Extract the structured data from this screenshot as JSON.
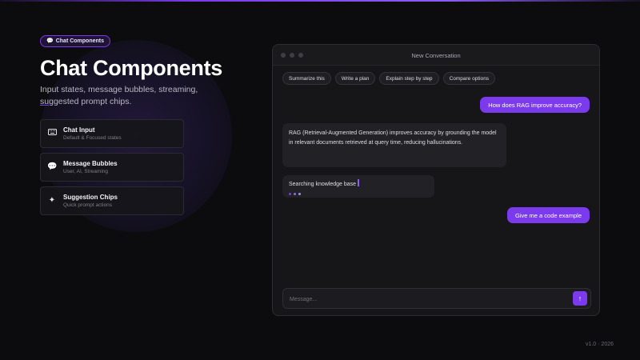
{
  "hero": {
    "badge_icon": "chat-bubble-icon",
    "badge_label": "Chat Components",
    "title": "Chat Components",
    "subtitle_a": "Input states, message bubbles, streaming, ",
    "subtitle_b": "sug",
    "subtitle_c": "gested prompt chips."
  },
  "cards": [
    {
      "icon": "keyboard-icon",
      "title": "Chat Input",
      "sub": "Default & Focused states"
    },
    {
      "icon": "speech-bubble-icon",
      "title": "Message Bubbles",
      "sub": "User, AI, Streaming"
    },
    {
      "icon": "sparkle-icon",
      "title": "Suggestion Chips",
      "sub": "Quick prompt actions"
    }
  ],
  "window": {
    "title": "New Conversation",
    "chips": [
      "Summarize this",
      "Write a plan",
      "Explain step by step",
      "Compare options"
    ],
    "messages": {
      "user1": "How does RAG improve accuracy?",
      "ai1": "RAG (Retrieval-Augmented Generation) improves accuracy by grounding the model in relevant documents retrieved at query time, reducing hallucinations.",
      "stream": "Searching knowledge base",
      "user2": "Give me a code example"
    },
    "composer": {
      "placeholder": "Message...",
      "value": ""
    }
  },
  "footer": {
    "version": "v1.0",
    "sep": "·",
    "year": "2026"
  },
  "colors": {
    "accent": "#7c3aed",
    "background": "#0c0c0e",
    "panel": "#161618"
  }
}
